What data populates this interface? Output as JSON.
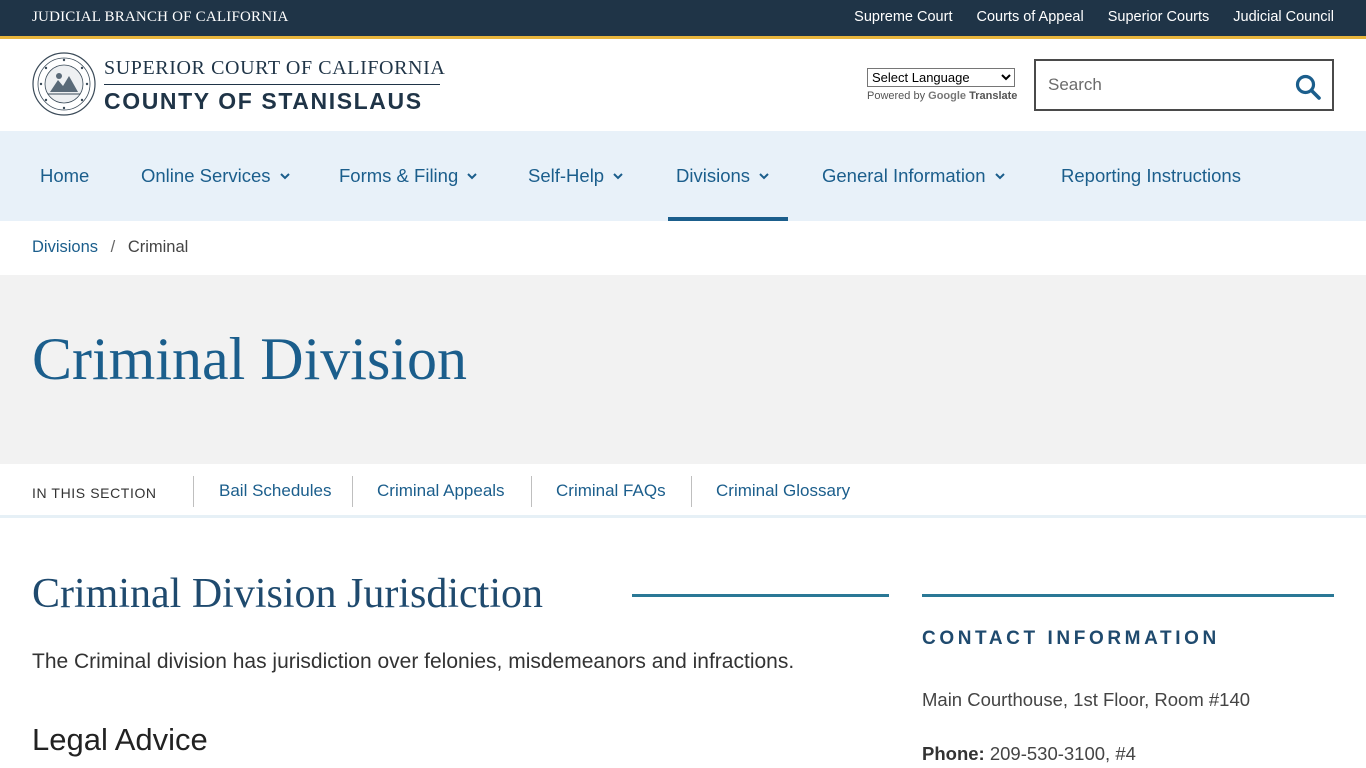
{
  "topbar": {
    "brand": "JUDICIAL BRANCH OF CALIFORNIA",
    "links": [
      "Supreme Court",
      "Courts of Appeal",
      "Superior Courts",
      "Judicial Council"
    ]
  },
  "header": {
    "logo_line1": "SUPERIOR COURT OF CALIFORNIA",
    "logo_line2": "COUNTY OF STANISLAUS",
    "language_select": "Select Language",
    "powered_by": "Powered by",
    "google": "Google",
    "translate": "Translate",
    "search_placeholder": "Search"
  },
  "nav": {
    "items": [
      {
        "label": "Home"
      },
      {
        "label": "Online Services"
      },
      {
        "label": "Forms & Filing"
      },
      {
        "label": "Self-Help"
      },
      {
        "label": "Divisions"
      },
      {
        "label": "General Information"
      },
      {
        "label": "Reporting Instructions"
      }
    ]
  },
  "breadcrumb": {
    "parent": "Divisions",
    "separator": "/",
    "current": "Criminal"
  },
  "hero": {
    "title": "Criminal Division"
  },
  "section_nav": {
    "label": "IN THIS SECTION",
    "links": [
      "Bail Schedules",
      "Criminal Appeals",
      "Criminal FAQs",
      "Criminal Glossary"
    ]
  },
  "content": {
    "title": "Criminal Division Jurisdiction",
    "paragraph": "The Criminal division has jurisdiction over felonies, misdemeanors and infractions.",
    "subheading": "Legal Advice"
  },
  "sidebar": {
    "heading": "CONTACT INFORMATION",
    "address": "Main Courthouse, 1st Floor, Room #140",
    "phone_label": "Phone:",
    "phone_value": "209-530-3100, #4"
  },
  "colors": {
    "topbar": "#1f3447",
    "accent_gold": "#e8b53c",
    "link_blue": "#1b5e8c",
    "nav_bg": "#e8f1f9",
    "hero_bg": "#f2f2f2",
    "rule_teal": "#2a7896"
  }
}
